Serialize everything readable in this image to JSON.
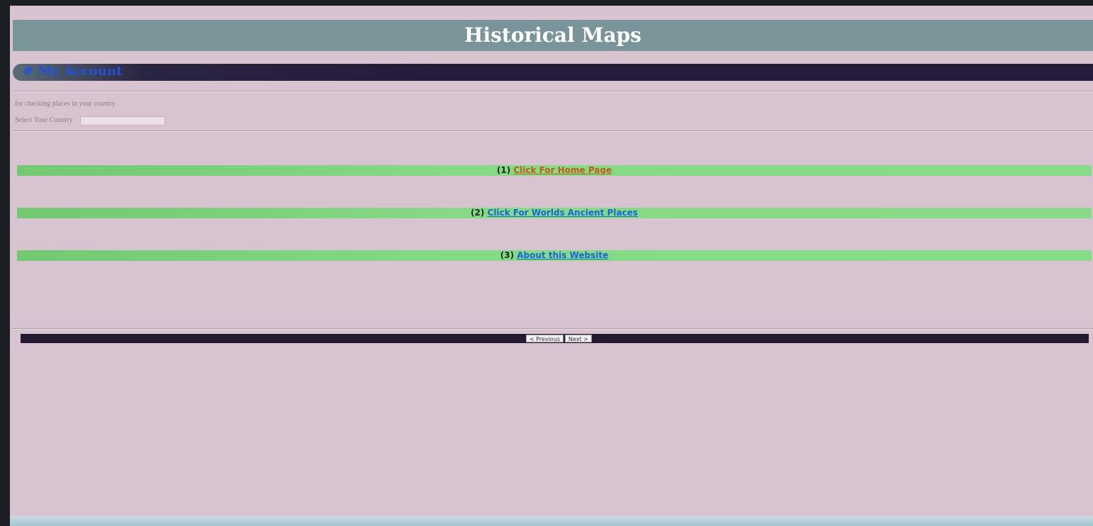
{
  "header": {
    "title": "Historical Maps"
  },
  "account": {
    "label": "# My Account"
  },
  "country_form": {
    "info": "for checking places in your country",
    "label": "Select Your Country",
    "value": ""
  },
  "links": [
    {
      "number": "(1)",
      "label": "Click For Home Page"
    },
    {
      "number": "(2)",
      "label": "Click For Worlds Ancient Places"
    },
    {
      "number": "(3)",
      "label": "About this Website"
    }
  ],
  "pager": {
    "previous": "< Previous",
    "next": "Next >"
  },
  "colors": {
    "page_bg": "#d8c3d1",
    "title_bg": "#7a9599",
    "account_bar": "#231c3a",
    "link_bar": "#86d985",
    "home_link": "#c15a1a",
    "link_blue": "#1766d8"
  }
}
